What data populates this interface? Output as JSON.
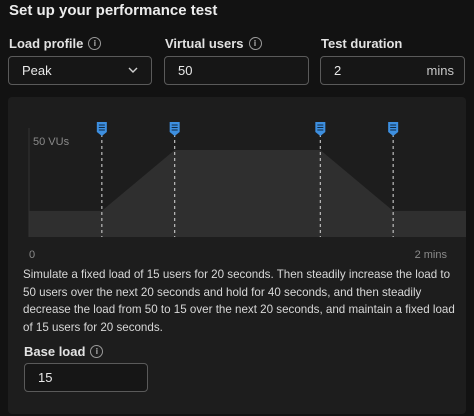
{
  "header": {
    "title": "Set up your performance test"
  },
  "load_profile": {
    "label": "Load profile",
    "info_icon": "info-icon",
    "value": "Peak"
  },
  "virtual_users": {
    "label": "Virtual users",
    "info_icon": "info-icon",
    "value": "50"
  },
  "test_duration": {
    "label": "Test duration",
    "value": "2",
    "unit": "mins"
  },
  "chart_data": {
    "type": "area",
    "x": [
      0,
      20,
      40,
      80,
      100,
      120
    ],
    "values": [
      15,
      15,
      50,
      50,
      15,
      15
    ],
    "x_tick_labels": [
      "0",
      "2 mins"
    ],
    "y_tick_label": "50 VUs",
    "xlim": [
      0,
      120
    ],
    "ylim": [
      0,
      50
    ],
    "marker_icon": "marker-icon",
    "markers_at": [
      20,
      40,
      80,
      100
    ],
    "colors": {
      "area": "#2f2f2f",
      "baseline": "#3a3a3a",
      "marker": "#3d8fe0",
      "dash": "#bdbdbd"
    }
  },
  "description": "Simulate a fixed load of 15 users for 20 seconds. Then steadily increase the load to 50 users over the next 20 seconds and hold for 40 seconds, and then steadily decrease the load from 50 to 15 over the next 20 seconds, and maintain a fixed load of 15 users for 20 seconds.",
  "base_load": {
    "label": "Base load",
    "info_icon": "info-icon",
    "value": "15"
  }
}
